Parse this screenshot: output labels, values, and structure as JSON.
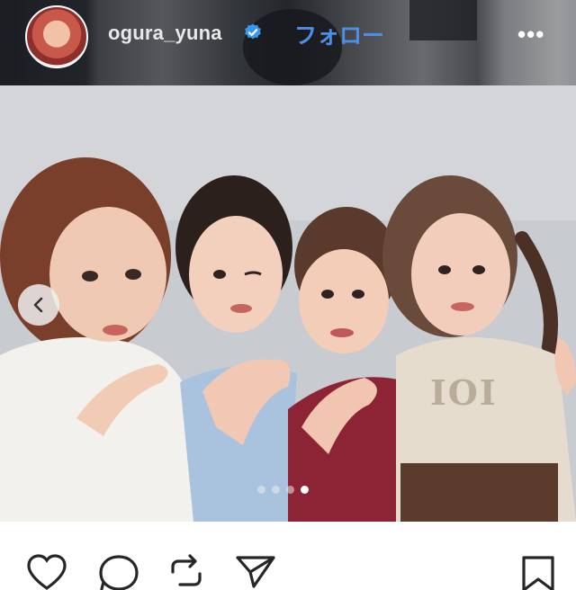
{
  "header": {
    "username": "ogura_yuna",
    "follow_label": "フォロー",
    "more_label": "•••",
    "avatar_icon": "profile-avatar",
    "verified_icon": "verified-badge-icon",
    "follow_color": "#4d8fe6",
    "verified_color": "#3897f0"
  },
  "post": {
    "image_description_icon": "group-photo",
    "carousel": {
      "total": 4,
      "active_index": 3
    },
    "prev_icon": "chevron-left-icon"
  },
  "actions": {
    "icons": [
      "heart-icon",
      "comment-icon",
      "repost-icon",
      "share-icon",
      "bookmark-icon"
    ]
  }
}
